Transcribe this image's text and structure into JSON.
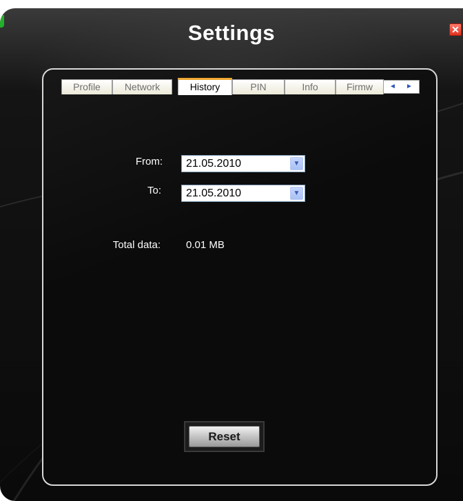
{
  "window": {
    "title": "Settings"
  },
  "tabs": [
    {
      "label": "Profile",
      "active": false
    },
    {
      "label": "Network",
      "active": false
    },
    {
      "label": "History",
      "active": true
    },
    {
      "label": "PIN",
      "active": false
    },
    {
      "label": "Info",
      "active": false
    },
    {
      "label": "Firmw",
      "active": false
    }
  ],
  "tab_scroll": {
    "left": "◄",
    "right": "►"
  },
  "history": {
    "from_label": "From:",
    "from_value": "21.05.2010",
    "to_label": "To:",
    "to_value": "21.05.2010",
    "total_label": "Total data:",
    "total_value": "0.01 MB",
    "reset_label": "Reset"
  },
  "icons": {
    "close": "close-icon",
    "dropdown": "chevron-down-icon"
  },
  "colors": {
    "accent": "#f0a830",
    "close": "#e0321f",
    "background": "#0a0a0a"
  }
}
